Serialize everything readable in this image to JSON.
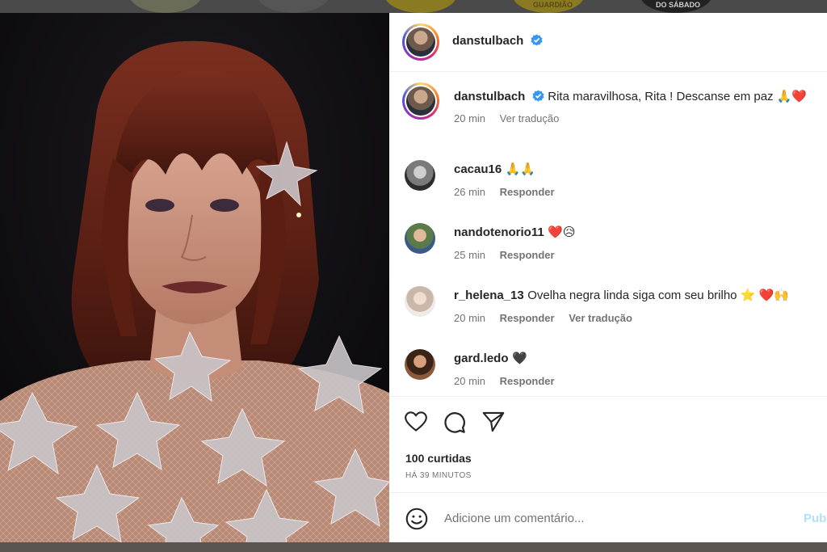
{
  "background": {
    "stories": [
      {
        "label": ""
      },
      {
        "label": ""
      },
      {
        "label": ""
      },
      {
        "label": "GUARDIÃO"
      },
      {
        "label": "DO SÁBADO"
      }
    ]
  },
  "header": {
    "username": "danstulbach",
    "verified": true
  },
  "caption": {
    "username": "danstulbach",
    "text": "Rita maravilhosa, Rita ! Descanse em paz 🙏❤️",
    "time": "20 min",
    "translate": "Ver tradução"
  },
  "comments": [
    {
      "username": "cacau16",
      "text": "🙏🙏",
      "time": "26 min",
      "reply": "Responder",
      "translate": ""
    },
    {
      "username": "nandotenorio11",
      "text": "❤️😥",
      "time": "25 min",
      "reply": "Responder",
      "translate": ""
    },
    {
      "username": "r_helena_13",
      "text": "Ovelha negra linda siga com seu brilho ⭐ ❤️🙌",
      "time": "20 min",
      "reply": "Responder",
      "translate": "Ver tradução"
    },
    {
      "username": "gard.ledo",
      "text": "🖤",
      "time": "20 min",
      "reply": "Responder",
      "translate": ""
    }
  ],
  "actions": {
    "like_icon": "heart-outline-icon",
    "comment_icon": "speech-bubble-icon",
    "share_icon": "paper-plane-icon",
    "likes": "100 curtidas",
    "posted": "HÁ 39 MINUTOS"
  },
  "composer": {
    "emoji_icon": "smiley-icon",
    "placeholder": "Adicione um comentário...",
    "publish": "Pub"
  },
  "colors": {
    "verified": "#3897f0",
    "text": "#262626",
    "muted": "#737373",
    "publish": "#b2dffc"
  }
}
